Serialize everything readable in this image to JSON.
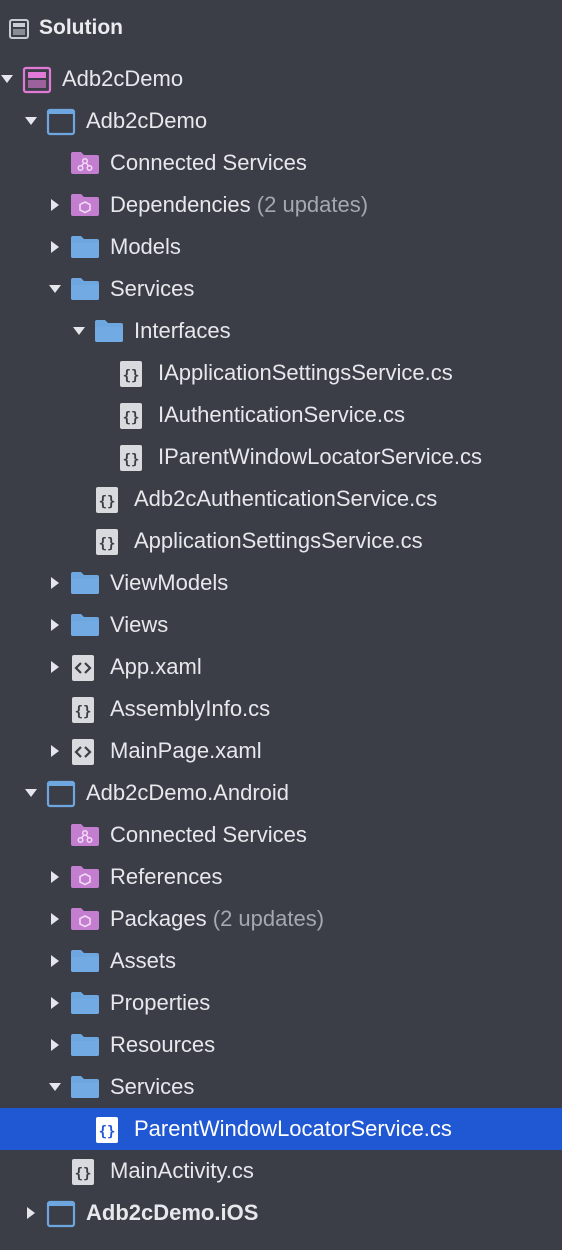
{
  "header": {
    "title": "Solution",
    "icon": "solution-icon"
  },
  "colors": {
    "background": "#3b3e47",
    "selection": "#2058d4",
    "folder": "#6ea6e0",
    "project": "#e07ad6"
  },
  "tree": [
    {
      "label": "Adb2cDemo",
      "level": 0,
      "arrow": "down",
      "icon": "solution-project-icon"
    },
    {
      "label": "Adb2cDemo",
      "level": 1,
      "arrow": "down",
      "icon": "project-icon"
    },
    {
      "label": "Connected Services",
      "level": 2,
      "arrow": "none",
      "icon": "connected-services-icon"
    },
    {
      "label": "Dependencies",
      "suffix": "(2 updates)",
      "level": 2,
      "arrow": "right",
      "icon": "package-folder-icon"
    },
    {
      "label": "Models",
      "level": 2,
      "arrow": "right",
      "icon": "folder-icon"
    },
    {
      "label": "Services",
      "level": 2,
      "arrow": "down",
      "icon": "folder-icon"
    },
    {
      "label": "Interfaces",
      "level": 3,
      "arrow": "down",
      "icon": "folder-icon"
    },
    {
      "label": "IApplicationSettingsService.cs",
      "level": 4,
      "arrow": "none",
      "icon": "csharp-file-icon"
    },
    {
      "label": "IAuthenticationService.cs",
      "level": 4,
      "arrow": "none",
      "icon": "csharp-file-icon"
    },
    {
      "label": "IParentWindowLocatorService.cs",
      "level": 4,
      "arrow": "none",
      "icon": "csharp-file-icon"
    },
    {
      "label": "Adb2cAuthenticationService.cs",
      "level": 3,
      "arrow": "none",
      "icon": "csharp-file-icon"
    },
    {
      "label": "ApplicationSettingsService.cs",
      "level": 3,
      "arrow": "none",
      "icon": "csharp-file-icon"
    },
    {
      "label": "ViewModels",
      "level": 2,
      "arrow": "right",
      "icon": "folder-icon"
    },
    {
      "label": "Views",
      "level": 2,
      "arrow": "right",
      "icon": "folder-icon"
    },
    {
      "label": "App.xaml",
      "level": 2,
      "arrow": "right",
      "icon": "xaml-file-icon"
    },
    {
      "label": "AssemblyInfo.cs",
      "level": 2,
      "arrow": "none",
      "icon": "csharp-file-icon"
    },
    {
      "label": "MainPage.xaml",
      "level": 2,
      "arrow": "right",
      "icon": "xaml-file-icon"
    },
    {
      "label": "Adb2cDemo.Android",
      "level": 1,
      "arrow": "down",
      "icon": "project-icon"
    },
    {
      "label": "Connected Services",
      "level": 2,
      "arrow": "none",
      "icon": "connected-services-icon"
    },
    {
      "label": "References",
      "level": 2,
      "arrow": "right",
      "icon": "package-folder-icon"
    },
    {
      "label": "Packages",
      "suffix": "(2 updates)",
      "level": 2,
      "arrow": "right",
      "icon": "package-folder-icon"
    },
    {
      "label": "Assets",
      "level": 2,
      "arrow": "right",
      "icon": "folder-icon"
    },
    {
      "label": "Properties",
      "level": 2,
      "arrow": "right",
      "icon": "folder-icon"
    },
    {
      "label": "Resources",
      "level": 2,
      "arrow": "right",
      "icon": "folder-icon"
    },
    {
      "label": "Services",
      "level": 2,
      "arrow": "down",
      "icon": "folder-icon"
    },
    {
      "label": "ParentWindowLocatorService.cs",
      "level": 3,
      "arrow": "none",
      "icon": "csharp-file-icon",
      "selected": true
    },
    {
      "label": "MainActivity.cs",
      "level": 2,
      "arrow": "none",
      "icon": "csharp-file-icon"
    },
    {
      "label": "Adb2cDemo.iOS",
      "level": 1,
      "arrow": "right",
      "icon": "project-icon",
      "bold": true
    }
  ]
}
